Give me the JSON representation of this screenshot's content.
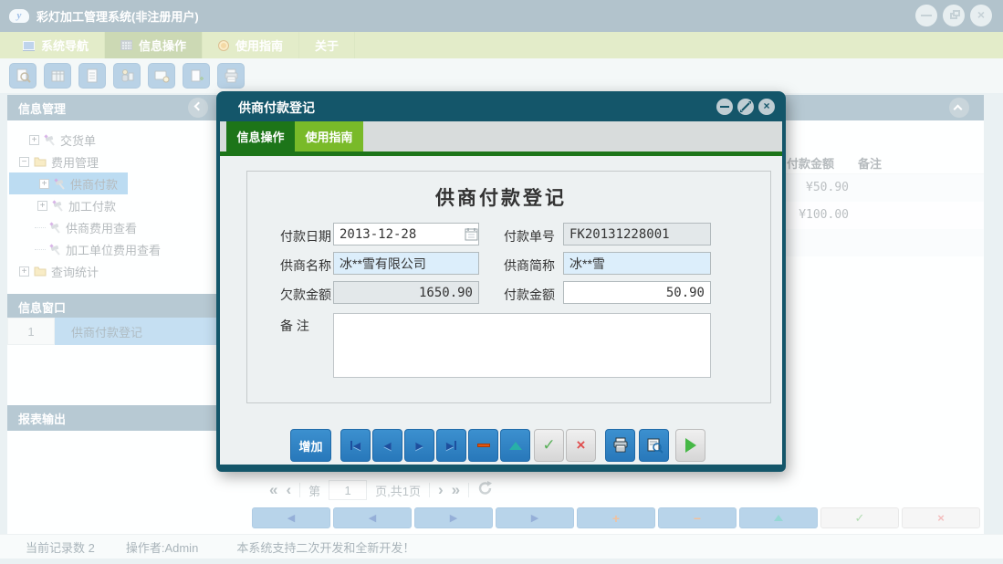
{
  "window": {
    "title": "彩灯加工管理系统(非注册用户)"
  },
  "menu": {
    "tabs": [
      "系统导航",
      "信息操作",
      "使用指南",
      "关于"
    ]
  },
  "toolbar_icons": [
    "preview-search",
    "table-view",
    "document",
    "user-station",
    "monitor-search",
    "document-add",
    "printer"
  ],
  "sidebar": {
    "info_mgmt_title": "信息管理",
    "tree": [
      {
        "label": "交货单"
      },
      {
        "label": "费用管理"
      },
      {
        "label": "供商付款"
      },
      {
        "label": "加工付款"
      },
      {
        "label": "供商费用查看"
      },
      {
        "label": "加工单位费用查看"
      },
      {
        "label": "查询统计"
      }
    ],
    "info_window_title": "信息窗口",
    "info_rows": [
      {
        "num": "1",
        "label": "供商付款登记"
      }
    ],
    "report_title": "报表输出"
  },
  "content": {
    "columns": [
      "付款金额",
      "备注"
    ],
    "rows": [
      "¥50.90",
      "¥100.00"
    ],
    "pagination": {
      "page_prefix": "第",
      "page": "1",
      "page_suffix": "页,共1页"
    }
  },
  "dialog": {
    "title": "供商付款登记",
    "tabs": [
      "信息操作",
      "使用指南"
    ],
    "heading": "供商付款登记",
    "fields": {
      "date_label": "付款日期",
      "date_value": "2013-12-28",
      "order_label": "付款单号",
      "order_value": "FK20131228001",
      "supplier_label": "供商名称",
      "supplier_value": "冰**雪有限公司",
      "short_label": "供商简称",
      "short_value": "冰**雪",
      "owed_label": "欠款金额",
      "owed_value": "1650.90",
      "amount_label": "付款金额",
      "amount_value": "50.90",
      "remark_label": "备 注"
    },
    "add_button": "增加"
  },
  "statusbar": {
    "records": "当前记录数 2",
    "operator": "操作者:Admin",
    "message": "本系统支持二次开发和全新开发！"
  },
  "icons": {
    "app_logo": "y",
    "close": "×",
    "arrow_left": "◀",
    "arrow_right": "▶",
    "check": "✓",
    "cross": "×",
    "plus": "+",
    "minus": "−",
    "page_first": "«",
    "page_prev": "‹",
    "page_next": "›",
    "page_last": "»"
  },
  "colors": {
    "dialog_header": "#14566a",
    "tab_dark_green": "#1d7519",
    "tab_light_green": "#79ba29",
    "primary_button_blue": "#2e82c4",
    "selected_tree_blue": "#79b9e5",
    "panel_header": "#6f93a7",
    "menu_green": "#c7d993"
  }
}
